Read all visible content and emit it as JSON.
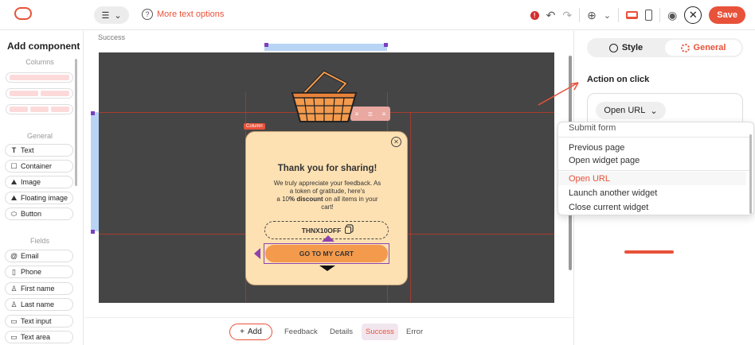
{
  "topbar": {
    "more_text_options": "More text options",
    "save_label": "Save"
  },
  "left_panel": {
    "title": "Add component",
    "sections": {
      "columns": "Columns",
      "general": "General",
      "fields": "Fields"
    },
    "general_items": [
      "Text",
      "Container",
      "Image",
      "Floating image",
      "Button"
    ],
    "field_items": [
      "Email",
      "Phone",
      "First name",
      "Last name",
      "Text input",
      "Text area"
    ]
  },
  "canvas": {
    "step_label": "Success",
    "column_tag": "Column",
    "popup": {
      "title": "Thank you for sharing!",
      "body_line1": "We truly appreciate your feedback. As",
      "body_line2": "a token of gratitude, here's",
      "body_line3_prefix": "a 10",
      "body_line3_bold": "% discount",
      "body_line3_suffix": " on all items in your",
      "body_line4": "cart!",
      "coupon_code": "THNX10OFF",
      "cta_label": "GO TO MY CART"
    }
  },
  "bottom_bar": {
    "add_label": "Add",
    "tabs": [
      "Feedback",
      "Details",
      "Success",
      "Error"
    ],
    "active_tab": "Success"
  },
  "right_panel": {
    "tab_style": "Style",
    "tab_general": "General",
    "action_on_click_label": "Action on click",
    "selected_action": "Open URL",
    "dropdown": {
      "partial_item": "Submit form",
      "group1": [
        "Previous page",
        "Open widget page"
      ],
      "group2": [
        "Open URL",
        "Launch another widget",
        "Close current widget"
      ],
      "highlighted": "Open URL"
    }
  },
  "colors": {
    "accent": "#e8523a",
    "stage_bg": "#454545",
    "popup_bg": "#fde1b3",
    "cta_bg": "#f39a4d",
    "selection": "#8e44ad"
  }
}
